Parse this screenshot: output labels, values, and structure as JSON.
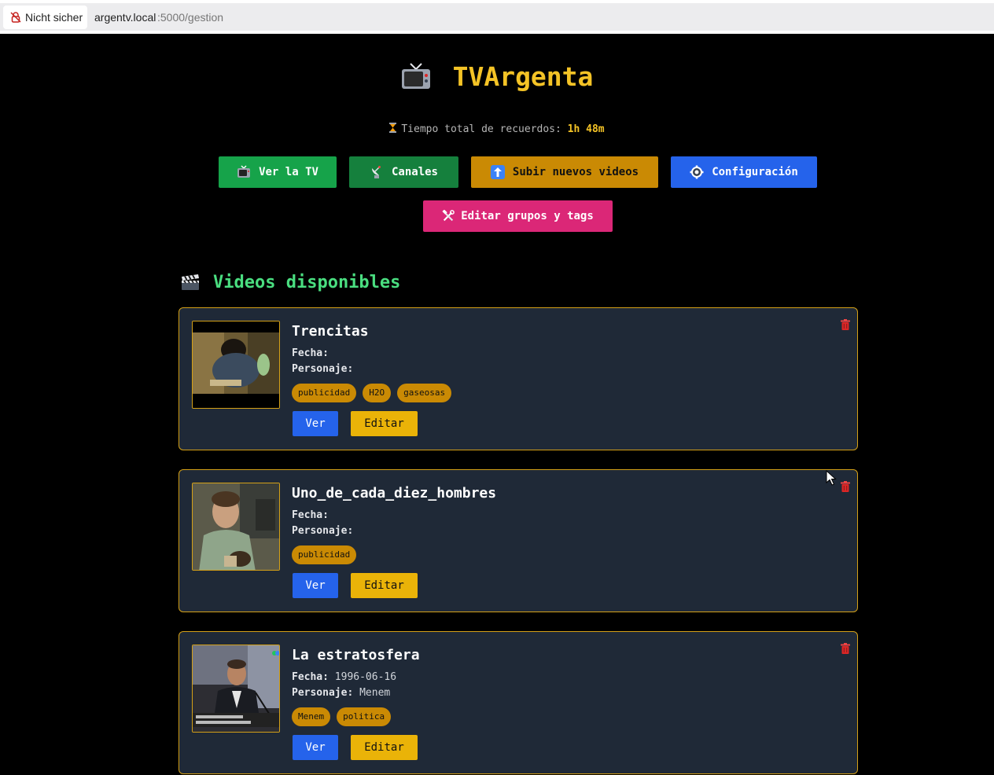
{
  "browser": {
    "security_label": "Nicht sicher",
    "url_host": "argentv.local",
    "url_path": ":5000/gestion"
  },
  "header": {
    "title": "TVArgenta"
  },
  "stats": {
    "label": "Tiempo total de recuerdos: ",
    "value": "1h 48m"
  },
  "nav": {
    "tv_label": "Ver la TV",
    "canales_label": "Canales",
    "subir_label": "Subir nuevos videos",
    "config_label": "Configuración",
    "editar_label": "Editar grupos y tags"
  },
  "section": {
    "title": "Videos disponibles"
  },
  "labels": {
    "fecha": "Fecha:",
    "personaje": "Personaje:",
    "ver": "Ver",
    "editar": "Editar"
  },
  "videos": [
    {
      "title": "Trencitas",
      "fecha": "",
      "personaje": "",
      "tags": [
        "publicidad",
        "H2O",
        "gaseosas"
      ]
    },
    {
      "title": "Uno_de_cada_diez_hombres",
      "fecha": "",
      "personaje": "",
      "tags": [
        "publicidad"
      ]
    },
    {
      "title": "La estratosfera",
      "fecha": "1996-06-16",
      "personaje": "Menem",
      "tags": [
        "Menem",
        "politica"
      ]
    }
  ],
  "colors": {
    "accent_yellow": "#f4c326",
    "heading_green": "#4ade80",
    "card_bg": "#1f2937",
    "card_border": "#d4a017",
    "tag_bg": "#ca8a04",
    "btn_blue": "#2563eb",
    "btn_pink": "#db2777"
  }
}
